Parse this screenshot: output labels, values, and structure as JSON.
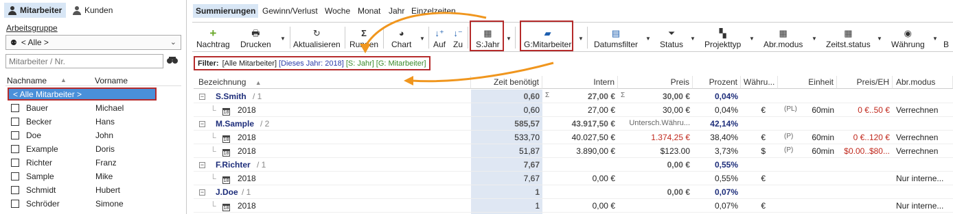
{
  "left_tabs": [
    {
      "label": "Mitarbeiter",
      "icon": "person-icon",
      "active": true
    },
    {
      "label": "Kunden",
      "icon": "person-icon",
      "active": false
    }
  ],
  "group": {
    "label": "Arbeitsgruppe",
    "selected": "< Alle >",
    "icon": "group-icon"
  },
  "search": {
    "placeholder": "Mitarbeiter / Nr."
  },
  "employee_table": {
    "headers": [
      "Nachname",
      "Vorname"
    ],
    "all_row": "< Alle Mitarbeiter >",
    "rows": [
      {
        "last": "Bauer",
        "first": "Michael"
      },
      {
        "last": "Becker",
        "first": "Hans"
      },
      {
        "last": "Doe",
        "first": "John"
      },
      {
        "last": "Example",
        "first": "Doris"
      },
      {
        "last": "Richter",
        "first": "Franz"
      },
      {
        "last": "Sample",
        "first": "Mike"
      },
      {
        "last": "Schmidt",
        "first": "Hubert"
      },
      {
        "last": "Schröder",
        "first": "Simone"
      }
    ]
  },
  "right_tabs": [
    "Summierungen",
    "Gewinn/Verlust",
    "Woche",
    "Monat",
    "Jahr",
    "Einzelzeiten"
  ],
  "toolbar": {
    "buttons": [
      {
        "label": "Nachtrag",
        "icon": "plus-icon"
      },
      {
        "label": "Drucken",
        "icon": "printer-icon"
      },
      {
        "label": "Aktualisieren",
        "icon": "refresh-icon"
      },
      {
        "label": "Runden",
        "icon": "sigma-icon"
      },
      {
        "label": "Chart",
        "icon": "pie-chart-icon"
      },
      {
        "label": "Auf",
        "icon": "sort-asc-icon"
      },
      {
        "label": "Zu",
        "icon": "sort-desc-icon"
      },
      {
        "label": "S:Jahr",
        "icon": "calculator-icon"
      },
      {
        "label": "G:Mitarbeiter",
        "icon": "folder-icon"
      },
      {
        "label": "Datumsfilter",
        "icon": "calendar-icon"
      },
      {
        "label": "Status",
        "icon": "funnel-icon"
      },
      {
        "label": "Projekttyp",
        "icon": "blocks-icon"
      },
      {
        "label": "Abr.modus",
        "icon": "calculator-icon"
      },
      {
        "label": "Zeitst.status",
        "icon": "calculator-icon"
      },
      {
        "label": "Währung",
        "icon": "currency-icon"
      },
      {
        "label": "B",
        "icon": "none"
      }
    ]
  },
  "filter": {
    "label": "Filter:",
    "value": "[Alle Mitarbeiter]",
    "year": "[Dieses Jahr: 2018]",
    "sum": "[S: Jahr]",
    "group": "[G: Mitarbeiter]"
  },
  "grid": {
    "headers": [
      "Bezeichnung",
      "Zeit benötigt",
      "Intern",
      "Preis",
      "Prozent",
      "Währu...",
      "Einheit",
      "Preis/EH",
      "Abr.modus"
    ],
    "rows": [
      {
        "kind": "group",
        "name": "S.Smith",
        "count": "/ 1",
        "zeit": "0,60",
        "sigma1": "Σ",
        "intern": "27,00 €",
        "sigma2": "Σ",
        "preis": "30,00 €",
        "prozent": "0,04%"
      },
      {
        "kind": "year",
        "name": "2018",
        "zeit": "0,60",
        "intern": "27,00 €",
        "preis": "30,00 €",
        "prozent": "0,04%",
        "waehrung": "€",
        "tag": "(PL)",
        "einheit": "60min",
        "preis_eh": "0 €..50 €",
        "abr": "Verrechnen"
      },
      {
        "kind": "group",
        "name": "M.Sample",
        "count": "/ 2",
        "zeit": "585,57",
        "intern": "43.917,50 €",
        "preis": "Untersch.Währu...",
        "prozent": "42,14%"
      },
      {
        "kind": "year",
        "name": "2018",
        "zeit": "533,70",
        "intern": "40.027,50 €",
        "preis": "1.374,25 €",
        "prozent": "38,40%",
        "waehrung": "€",
        "tag": "(P)",
        "einheit": "60min",
        "preis_eh": "0 €..120 €",
        "abr": "Verrechnen"
      },
      {
        "kind": "year",
        "name": "2018",
        "zeit": "51,87",
        "intern": "3.890,00 €",
        "preis": "$123.00",
        "prozent": "3,73%",
        "waehrung": "$",
        "tag": "(P)",
        "einheit": "60min",
        "preis_eh": "$0.00..$80...",
        "abr": "Verrechnen"
      },
      {
        "kind": "group",
        "name": "F.Richter",
        "count": "/ 1",
        "zeit": "7,67",
        "intern": "",
        "preis": "0,00 €",
        "prozent": "0,55%"
      },
      {
        "kind": "year",
        "name": "2018",
        "zeit": "7,67",
        "intern": "0,00 €",
        "preis": "",
        "prozent": "0,55%",
        "waehrung": "€",
        "tag": "",
        "einheit": "",
        "preis_eh": "",
        "abr": "Nur interne..."
      },
      {
        "kind": "group",
        "name": "J.Doe",
        "count": "/ 1",
        "zeit": "1",
        "intern": "",
        "preis": "0,00 €",
        "prozent": "0,07%"
      },
      {
        "kind": "year",
        "name": "2018",
        "zeit": "1",
        "intern": "0,00 €",
        "preis": "",
        "prozent": "0,07%",
        "waehrung": "€",
        "tag": "",
        "einheit": "",
        "preis_eh": "",
        "abr": "Nur interne..."
      }
    ]
  },
  "colors": {
    "highlight": "#b52a2a",
    "arrow": "#f0961e",
    "selected": "#4a90d9",
    "group_text": "#1d2d7a",
    "price_red": "#c0281c"
  }
}
